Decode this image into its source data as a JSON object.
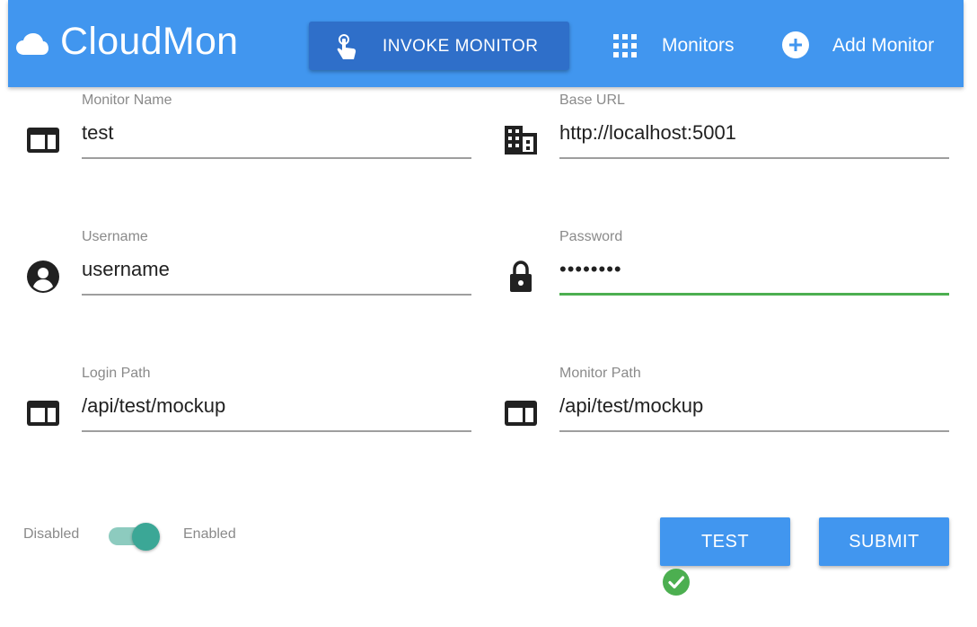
{
  "app": {
    "title": "CloudMon",
    "brand_icon": "cloud-icon",
    "accent_color": "#4196ef"
  },
  "header": {
    "invoke_button": {
      "label": "INVOKE MONITOR",
      "icon": "touch-hand-icon"
    },
    "nav": [
      {
        "label": "Monitors",
        "icon": "grid-icon"
      },
      {
        "label": "Add Monitor",
        "icon": "add-circle-icon"
      }
    ]
  },
  "form": {
    "monitor_name": {
      "label": "Monitor Name",
      "value": "test",
      "icon": "web-window-icon"
    },
    "base_url": {
      "label": "Base URL",
      "value": "http://localhost:5001",
      "icon": "building-icon"
    },
    "username": {
      "label": "Username",
      "value": "username",
      "icon": "account-circle-icon"
    },
    "password": {
      "label": "Password",
      "value": "••••••••",
      "icon": "lock-icon"
    },
    "login_path": {
      "label": "Login Path",
      "value": "/api/test/mockup",
      "icon": "web-window-icon"
    },
    "monitor_path": {
      "label": "Monitor Path",
      "value": "/api/test/mockup",
      "icon": "web-window-icon"
    }
  },
  "toggle": {
    "off_label": "Disabled",
    "on_label": "Enabled",
    "state": "on",
    "color": "#3ba796"
  },
  "actions": {
    "test_label": "TEST",
    "submit_label": "SUBMIT",
    "test_status": {
      "icon": "check-circle-icon",
      "color": "#4caf50"
    }
  }
}
